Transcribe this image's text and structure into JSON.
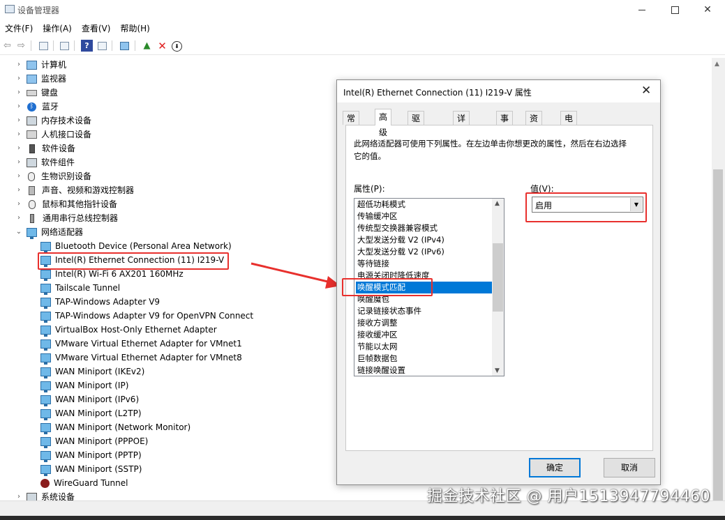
{
  "window": {
    "title": "设备管理器"
  },
  "menu": [
    "文件(F)",
    "操作(A)",
    "查看(V)",
    "帮助(H)"
  ],
  "tree": {
    "categories": [
      {
        "label": "计算机",
        "icon": "computer-icon"
      },
      {
        "label": "监视器",
        "icon": "monitor-icon"
      },
      {
        "label": "键盘",
        "icon": "keyboard-icon"
      },
      {
        "label": "蓝牙",
        "icon": "bluetooth-icon"
      },
      {
        "label": "内存技术设备",
        "icon": "memory-icon"
      },
      {
        "label": "人机接口设备",
        "icon": "hid-icon"
      },
      {
        "label": "软件设备",
        "icon": "software-device-icon"
      },
      {
        "label": "软件组件",
        "icon": "software-component-icon"
      },
      {
        "label": "生物识别设备",
        "icon": "biometric-icon"
      },
      {
        "label": "声音、视频和游戏控制器",
        "icon": "speaker-icon"
      },
      {
        "label": "鼠标和其他指针设备",
        "icon": "mouse-icon"
      },
      {
        "label": "通用串行总线控制器",
        "icon": "usb-icon"
      },
      {
        "label": "网络适配器",
        "icon": "network-adapter-icon"
      }
    ],
    "adapters": [
      "Bluetooth Device (Personal Area Network)",
      "Intel(R) Ethernet Connection (11) I219-V",
      "Intel(R) Wi-Fi 6 AX201 160MHz",
      "Tailscale Tunnel",
      "TAP-Windows Adapter V9",
      "TAP-Windows Adapter V9 for OpenVPN Connect",
      "VirtualBox Host-Only Ethernet Adapter",
      "VMware Virtual Ethernet Adapter for VMnet1",
      "VMware Virtual Ethernet Adapter for VMnet8",
      "WAN Miniport (IKEv2)",
      "WAN Miniport (IP)",
      "WAN Miniport (IPv6)",
      "WAN Miniport (L2TP)",
      "WAN Miniport (Network Monitor)",
      "WAN Miniport (PPPOE)",
      "WAN Miniport (PPTP)",
      "WAN Miniport (SSTP)",
      "WireGuard Tunnel"
    ],
    "last_category": "系统设备"
  },
  "dialog": {
    "title": "Intel(R) Ethernet Connection (11) I219-V 属性",
    "tabs": [
      "常规",
      "高级",
      "驱动程序",
      "详细信息",
      "事件",
      "资源",
      "电源管理"
    ],
    "active_tab": "高级",
    "description": "此网络适配器可使用下列属性。在左边单击你想更改的属性，然后在右边选择它的值。",
    "property_label": "属性(P):",
    "value_label": "值(V):",
    "properties": [
      "超低功耗模式",
      "传输缓冲区",
      "传统型交换器兼容模式",
      "大型发送分载 V2 (IPv4)",
      "大型发送分载 V2 (IPv6)",
      "等待链接",
      "电源关闭时降低速度",
      "唤醒模式匹配",
      "唤醒魔包",
      "记录链接状态事件",
      "接收方调整",
      "接收缓冲区",
      "节能以太网",
      "巨帧数据包",
      "链接唤醒设置"
    ],
    "selected_property": "唤醒模式匹配",
    "value": "启用",
    "ok_label": "确定",
    "cancel_label": "取消"
  },
  "watermark": "掘金技术社区 @ 用户1513947794460",
  "colors": {
    "highlight": "#e8302d",
    "selection": "#0078d7"
  }
}
